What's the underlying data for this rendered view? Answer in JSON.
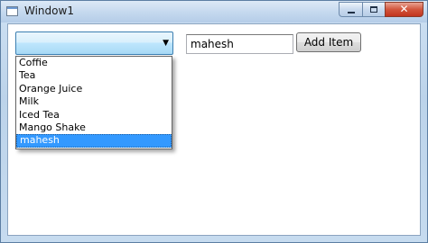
{
  "window": {
    "title": "Window1",
    "close_glyph": "✕"
  },
  "combo": {
    "selected_value": "",
    "arrow_glyph": "▼",
    "items": [
      "Coffie",
      "Tea",
      "Orange Juice",
      "Milk",
      "Iced Tea",
      "Mango Shake",
      "mahesh"
    ],
    "highlighted_index": 6
  },
  "textbox": {
    "value": "mahesh"
  },
  "add_button": {
    "label": "Add Item"
  },
  "colors": {
    "highlight": "#3399ff",
    "combo_border": "#3c7fb1",
    "title_bar": "#c4d8ee"
  }
}
